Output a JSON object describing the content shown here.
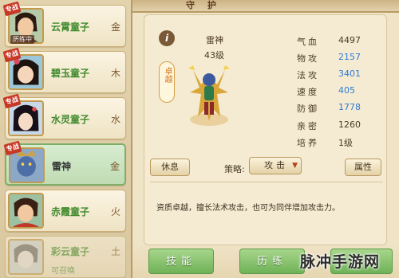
{
  "header": {
    "title": "守 护"
  },
  "hero_list": [
    {
      "name": "云霄童子",
      "element": "金",
      "badge": "专战",
      "subtag": "历练中",
      "selected": false,
      "locked": false
    },
    {
      "name": "碧玉童子",
      "element": "木",
      "badge": "专战",
      "selected": false,
      "locked": false
    },
    {
      "name": "水灵童子",
      "element": "水",
      "badge": "专战",
      "selected": false,
      "locked": false
    },
    {
      "name": "雷神",
      "element": "金",
      "badge": "专战",
      "selected": true,
      "locked": false
    },
    {
      "name": "赤霞童子",
      "element": "火",
      "selected": false,
      "locked": false
    },
    {
      "name": "彩云童子",
      "element": "土",
      "sub": "可召唤",
      "selected": false,
      "locked": true
    }
  ],
  "pet": {
    "name": "雷神",
    "level": "43级",
    "quality": "卓越"
  },
  "stats": [
    {
      "label": "气血",
      "value": "4497",
      "color": "dark"
    },
    {
      "label": "物攻",
      "value": "2157",
      "color": "blue"
    },
    {
      "label": "法攻",
      "value": "3401",
      "color": "blue"
    },
    {
      "label": "速度",
      "value": "405",
      "color": "blue"
    },
    {
      "label": "防御",
      "value": "1778",
      "color": "blue"
    },
    {
      "label": "亲密",
      "value": "1260",
      "color": "dark"
    },
    {
      "label": "培养",
      "value": "1级",
      "color": "dark"
    }
  ],
  "controls": {
    "rest_label": "休息",
    "strategy_label": "策略:",
    "strategy_value": "攻击",
    "attr_label": "属性"
  },
  "description": "资质卓越，擅长法术攻击，也可为同伴增加攻击力。",
  "tabs": [
    {
      "label": "技能"
    },
    {
      "label": "历练"
    },
    {
      "label": ""
    }
  ],
  "watermark": "脉冲手游网",
  "colors": {
    "accent_green": "#6fb257",
    "stat_blue": "#2e7ad8",
    "name_green": "#3f8a2c"
  }
}
